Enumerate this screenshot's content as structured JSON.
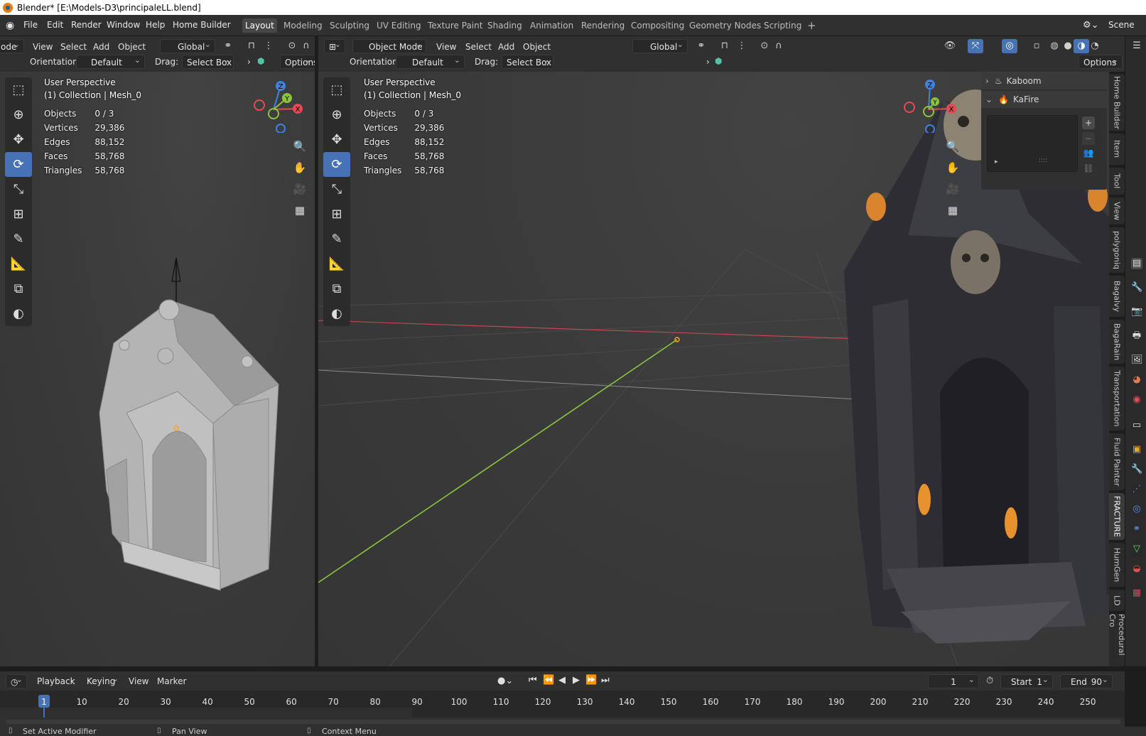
{
  "window": {
    "title": "Blender* [E:\\Models-D3\\principaleLL.blend]"
  },
  "menu": {
    "items": [
      "File",
      "Edit",
      "Render",
      "Window",
      "Help",
      "Home Builder"
    ]
  },
  "workspaces": [
    "Layout",
    "Modeling",
    "Sculpting",
    "UV Editing",
    "Texture Paint",
    "Shading",
    "Animation",
    "Rendering",
    "Compositing",
    "Geometry Nodes",
    "Scripting"
  ],
  "scene": {
    "name": "Scene",
    "add_tab": "+"
  },
  "left_view": {
    "mode": "ode",
    "menus": [
      "View",
      "Select",
      "Add",
      "Object"
    ],
    "transform": "Global",
    "orientation_label": "Orientation:",
    "orientation_value": "Default",
    "drag_label": "Drag:",
    "drag_value": "Select Box",
    "options": "Options",
    "perspective": "User Perspective",
    "collection": "(1) Collection | Mesh_0"
  },
  "main_view": {
    "mode": "Object Mode",
    "menus": [
      "View",
      "Select",
      "Add",
      "Object"
    ],
    "transform": "Global",
    "orientation_label": "Orientation:",
    "orientation_value": "Default",
    "drag_label": "Drag:",
    "drag_value": "Select Box",
    "options": "Options",
    "perspective": "User Perspective",
    "collection": "(1) Collection | Mesh_0"
  },
  "stats": [
    {
      "label": "Objects",
      "value": "0 / 3"
    },
    {
      "label": "Vertices",
      "value": "29,386"
    },
    {
      "label": "Edges",
      "value": "88,152"
    },
    {
      "label": "Faces",
      "value": "58,768"
    },
    {
      "label": "Triangles",
      "value": "58,768"
    }
  ],
  "gizmo": {
    "z": "Z",
    "y": "Y",
    "x": "X"
  },
  "npanel": {
    "items": [
      {
        "label": "Kaboom",
        "expanded": false
      },
      {
        "label": "KaFire",
        "expanded": true
      }
    ],
    "list_add": "+",
    "list_remove": "−",
    "list_handle": "::::"
  },
  "side_tabs": [
    "Home Builder",
    "Item",
    "Tool",
    "View",
    "polygoniq",
    "Bagalvy",
    "BagaRain",
    "Transportation",
    "Fluid Painter",
    "FRACTURE",
    "HumGen",
    "LD",
    "Procedural Cro"
  ],
  "timeline": {
    "menus": [
      "Playback",
      "Keying",
      "View",
      "Marker"
    ],
    "current_frame": "1",
    "start_label": "Start",
    "start_value": "1",
    "end_label": "End",
    "end_value": "90",
    "ticks": [
      "1",
      "10",
      "20",
      "30",
      "40",
      "50",
      "60",
      "70",
      "80",
      "90",
      "100",
      "110",
      "120",
      "130",
      "140",
      "150",
      "160",
      "170",
      "180",
      "190",
      "200",
      "210",
      "220",
      "230",
      "240",
      "250"
    ],
    "tick_frames": [
      1,
      10,
      20,
      30,
      40,
      50,
      60,
      70,
      80,
      90,
      100,
      110,
      120,
      130,
      140,
      150,
      160,
      170,
      180,
      190,
      200,
      210,
      220,
      230,
      240,
      250
    ]
  },
  "statusbar": {
    "left": "Set Active Modifier",
    "middle": "Pan View",
    "right": "Context Menu"
  },
  "colors": {
    "accent": "#4772b3",
    "header": "#303030",
    "viewport": "#3b3b3b",
    "axis_x": "#e24a55",
    "axis_y": "#8bc43f",
    "axis_z": "#3d83e0",
    "frame_marker": "#4772b3"
  }
}
